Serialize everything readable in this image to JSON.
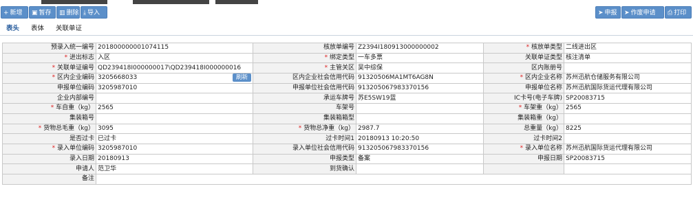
{
  "toolbar": {
    "left": [
      {
        "icon": "plus-icon",
        "label": "新增"
      },
      {
        "icon": "save-icon",
        "label": "暂存"
      },
      {
        "icon": "delete-icon",
        "label": "删除"
      },
      {
        "icon": "import-icon",
        "label": "导入"
      }
    ],
    "right": [
      {
        "icon": "send-icon",
        "label": "申报"
      },
      {
        "icon": "send-icon",
        "label": "作废申请"
      },
      {
        "icon": "print-icon",
        "label": "打印"
      }
    ]
  },
  "tabs": [
    "表头",
    "表体",
    "关联单证"
  ],
  "form": {
    "refresh_label": "刷新",
    "rows": [
      [
        {
          "label": "预录入统一编号",
          "req": false,
          "value": "201800000001074115"
        },
        {
          "label": "核放单编号",
          "req": false,
          "value": "Z2394I180913000000002"
        },
        {
          "label": "核放单类型",
          "req": true,
          "value": "二线进出区"
        }
      ],
      [
        {
          "label": "进出标志",
          "req": true,
          "value": "入区"
        },
        {
          "label": "绑定类型",
          "req": true,
          "value": "一车多票"
        },
        {
          "label": "关联单证类型",
          "req": false,
          "value": "核注清单"
        }
      ],
      [
        {
          "label": "关联单证编号",
          "req": true,
          "value": "QD239418I000000017\\QD239418I000000016"
        },
        {
          "label": "主管关区",
          "req": true,
          "value": "吴中综保"
        },
        {
          "label": "区内账册号",
          "req": false,
          "value": ""
        }
      ],
      [
        {
          "label": "区内企业编码",
          "req": true,
          "value": "3205668033"
        },
        {
          "label": "区内企业社会信用代码",
          "req": false,
          "value": "91320506MA1MT6AG8N"
        },
        {
          "label": "区内企业名称",
          "req": true,
          "value": "苏州迅航仓储服务有限公司"
        }
      ],
      [
        {
          "label": "申报单位编码",
          "req": false,
          "value": "3205987010"
        },
        {
          "label": "申报单位社会信用代码",
          "req": false,
          "value": "913205067983370156"
        },
        {
          "label": "申报单位名称",
          "req": false,
          "value": "苏州迅航国际货运代理有限公司"
        }
      ],
      [
        {
          "label": "企业内部编号",
          "req": false,
          "value": ""
        },
        {
          "label": "承运车牌号",
          "req": false,
          "value": "苏E5SW19蓝"
        },
        {
          "label": "IC卡号(电子车牌)",
          "req": false,
          "value": "SP20083715"
        }
      ],
      [
        {
          "label": "车自重（kg）",
          "req": true,
          "value": "2565"
        },
        {
          "label": "车架号",
          "req": false,
          "value": ""
        },
        {
          "label": "车架重（kg）",
          "req": true,
          "value": "2565"
        }
      ],
      [
        {
          "label": "集装箱号",
          "req": false,
          "value": ""
        },
        {
          "label": "集装箱箱型",
          "req": false,
          "value": ""
        },
        {
          "label": "集装箱重（kg）",
          "req": false,
          "value": ""
        }
      ],
      [
        {
          "label": "货物总毛重（kg）",
          "req": true,
          "value": "3095"
        },
        {
          "label": "货物总净重（kg）",
          "req": true,
          "value": "2987.7"
        },
        {
          "label": "总重量（kg）",
          "req": false,
          "value": "8225"
        }
      ],
      [
        {
          "label": "是否过卡",
          "req": false,
          "value": "已过卡"
        },
        {
          "label": "过卡时间1",
          "req": false,
          "value": "20180913 10:20:50"
        },
        {
          "label": "过卡时间2",
          "req": false,
          "value": ""
        }
      ],
      [
        {
          "label": "录入单位编码",
          "req": true,
          "value": "3205987010"
        },
        {
          "label": "录入单位社会信用代码",
          "req": false,
          "value": "913205067983370156"
        },
        {
          "label": "录入单位名称",
          "req": true,
          "value": "苏州迅航国际货运代理有限公司"
        }
      ],
      [
        {
          "label": "录入日期",
          "req": false,
          "value": "20180913"
        },
        {
          "label": "申报类型",
          "req": false,
          "value": "备案"
        },
        {
          "label": "申报日期",
          "req": false,
          "value": "SP20083715"
        }
      ],
      [
        {
          "label": "申请人",
          "req": false,
          "value": "范卫华"
        },
        {
          "label": "到货确认",
          "req": false,
          "value": ""
        },
        {
          "label": "",
          "req": false,
          "value": ""
        }
      ],
      [
        {
          "label": "备注",
          "req": false,
          "value": ""
        }
      ]
    ]
  }
}
